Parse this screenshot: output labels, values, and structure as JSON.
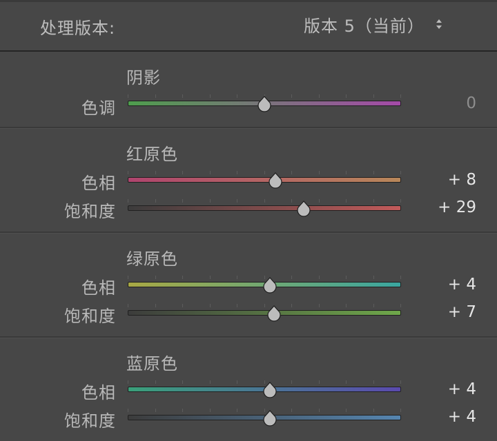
{
  "header": {
    "process_label": "处理版本:",
    "version_value": "版本 5（当前）"
  },
  "sections": [
    {
      "title": "阴影",
      "rows": [
        {
          "label": "色调",
          "value": "0",
          "position": 0.5,
          "gradient": [
            "#4e9d4d",
            "#a44aa8"
          ]
        }
      ]
    },
    {
      "title": "红原色",
      "rows": [
        {
          "label": "色相",
          "value": "+ 8",
          "position": 0.54,
          "gradient": [
            "#b0446e",
            "#b8875a"
          ]
        },
        {
          "label": "饱和度",
          "value": "+ 29",
          "position": 0.645,
          "gradient": [
            "#3c3c3c",
            "#c25a5a"
          ]
        }
      ]
    },
    {
      "title": "绿原色",
      "rows": [
        {
          "label": "色相",
          "value": "+ 4",
          "position": 0.52,
          "gradient": [
            "#a8a844",
            "#3aa6a0"
          ]
        },
        {
          "label": "饱和度",
          "value": "+ 7",
          "position": 0.535,
          "gradient": [
            "#3c3c3c",
            "#6fa84a"
          ]
        }
      ]
    },
    {
      "title": "蓝原色",
      "rows": [
        {
          "label": "色相",
          "value": "+ 4",
          "position": 0.52,
          "gradient": [
            "#3aa07a",
            "#5a4aae"
          ]
        },
        {
          "label": "饱和度",
          "value": "+ 4",
          "position": 0.52,
          "gradient": [
            "#3c3c3c",
            "#5585b0"
          ]
        }
      ]
    }
  ],
  "colors": {
    "panel_bg": "#474747",
    "label_text": "#b8b8b8",
    "value_text": "#e6e6e6",
    "thumb": "#bcbcbc"
  }
}
